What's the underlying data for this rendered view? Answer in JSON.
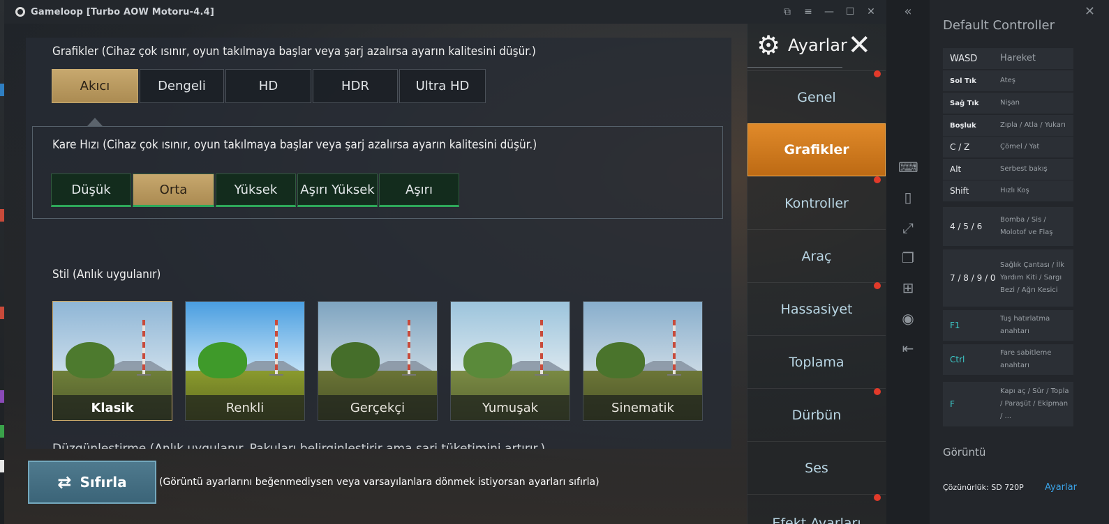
{
  "window": {
    "title": "Gameloop  [Turbo AOW Motoru-4.4]"
  },
  "graphics": {
    "heading": "Grafikler (Cihaz çok ısınır, oyun takılmaya başlar veya şarj azalırsa ayarın kalitesini düşür.)",
    "options": [
      "Akıcı",
      "Dengeli",
      "HD",
      "HDR",
      "Ultra HD"
    ],
    "selected": "Akıcı"
  },
  "framerate": {
    "heading": "Kare Hızı (Cihaz çok ısınır, oyun takılmaya başlar veya şarj azalırsa ayarın kalitesini düşür.)",
    "options": [
      "Düşük",
      "Orta",
      "Yüksek",
      "Aşırı Yüksek",
      "Aşırı"
    ],
    "selected": "Orta"
  },
  "style": {
    "heading": "Stil (Anlık uygulanır)",
    "options": [
      "Klasik",
      "Renkli",
      "Gerçekçi",
      "Yumuşak",
      "Sinematik"
    ],
    "selected": "Klasik"
  },
  "cut_heading": "Düzgünleştirme (Anlık uygulanır. Pakuları belirginleştirir ama şarj tüketimini artırır.)",
  "reset": {
    "label": "Sıfırla",
    "note": "(Görüntü ayarlarını beğenmediysen veya varsayılanlara dönmek istiyorsan ayarları sıfırla)"
  },
  "settings_menu": {
    "title": "Ayarlar",
    "items": [
      "Genel",
      "Grafikler",
      "Kontroller",
      "Araç",
      "Hassasiyet",
      "Toplama",
      "Dürbün",
      "Ses",
      "Efekt Ayarları"
    ],
    "selected": "Grafikler"
  },
  "controller": {
    "title": "Default Controller",
    "rows": [
      {
        "key": "WASD",
        "action": "Hareket"
      },
      {
        "key": "Sol Tık",
        "action": "Ateş"
      },
      {
        "key": "Sağ Tık",
        "action": "Nişan"
      },
      {
        "key": "Boşluk",
        "action": "Zıpla / Atla / Yukarı"
      },
      {
        "key": "C / Z",
        "action": "Çömel / Yat"
      },
      {
        "key": "Alt",
        "action": "Serbest bakış"
      },
      {
        "key": "Shift",
        "action": "Hızlı Koş"
      },
      {
        "key": "4 / 5 / 6",
        "action": "Bomba / Sis / Molotof ve Flaş"
      },
      {
        "key": "7 / 8 / 9 / 0",
        "action": "Sağlık Çantası / İlk Yardım Kiti / Sargı Bezi / Ağrı Kesici"
      },
      {
        "key": "F1",
        "action": "Tuş hatırlatma anahtarı"
      },
      {
        "key": "Ctrl",
        "action": "Fare sabitleme anahtarı"
      },
      {
        "key": "F",
        "action": "Kapı aç / Sür / Topla / Paraşüt / Ekipman / ..."
      }
    ],
    "view_title": "Görüntü",
    "resolution_label": "Çözünürlük: SD 720P",
    "settings_link": "Ayarlar"
  },
  "colors": {
    "accent_orange": "#d97a1e",
    "gold_selected": "#c7a86e",
    "fps_green": "#2ea85a",
    "link_blue": "#3aa2e6",
    "notification_red": "#e23a2a"
  }
}
